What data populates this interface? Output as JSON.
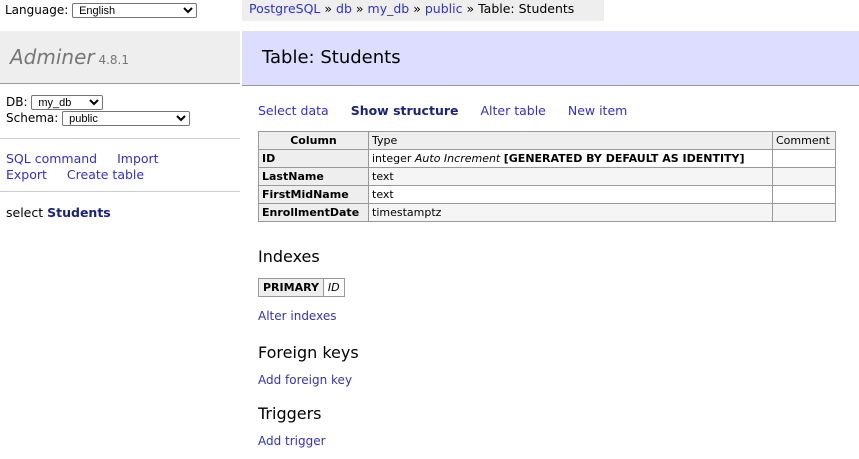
{
  "language": {
    "label": "Language:",
    "selected": "English"
  },
  "breadcrumb": {
    "root": "PostgreSQL",
    "sep": "»",
    "db": "db",
    "database": "my_db",
    "schema": "public",
    "current": "Table: Students"
  },
  "brand": {
    "name": "Adminer",
    "version": "4.8.1"
  },
  "db_box": {
    "db_label": "DB:",
    "db_value": "my_db",
    "schema_label": "Schema:",
    "schema_value": "public"
  },
  "side_links": {
    "sql_command": "SQL command",
    "import": "Import",
    "export": "Export",
    "create_table": "Create table"
  },
  "table_list": {
    "prefix": "select",
    "table": "Students"
  },
  "page_title": "Table: Students",
  "tabs": {
    "select_data": "Select data",
    "show_structure": "Show structure",
    "alter_table": "Alter table",
    "new_item": "New item"
  },
  "structure": {
    "headers": {
      "column": "Column",
      "type": "Type",
      "comment": "Comment"
    },
    "rows": [
      {
        "name": "ID",
        "type": "integer",
        "extra_italic": "Auto Increment",
        "extra_bold": "[GENERATED BY DEFAULT AS IDENTITY]",
        "comment": ""
      },
      {
        "name": "LastName",
        "type": "text",
        "comment": ""
      },
      {
        "name": "FirstMidName",
        "type": "text",
        "comment": ""
      },
      {
        "name": "EnrollmentDate",
        "type": "timestamptz",
        "comment": ""
      }
    ]
  },
  "indexes": {
    "title": "Indexes",
    "type": "PRIMARY",
    "column": "ID",
    "alter_link": "Alter indexes"
  },
  "foreign_keys": {
    "title": "Foreign keys",
    "add_link": "Add foreign key"
  },
  "triggers": {
    "title": "Triggers",
    "add_link": "Add trigger"
  }
}
